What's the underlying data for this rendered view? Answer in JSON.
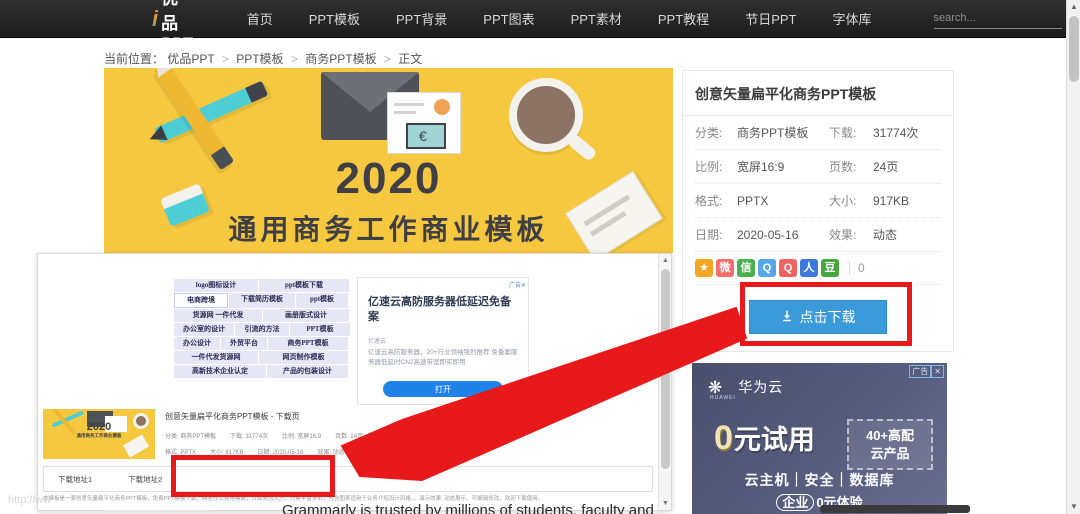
{
  "site": {
    "brand_mark": "i",
    "brand_name": "优品PPT",
    "nav": [
      {
        "label": "首页"
      },
      {
        "label": "PPT模板"
      },
      {
        "label": "PPT背景"
      },
      {
        "label": "PPT图表"
      },
      {
        "label": "PPT素材"
      },
      {
        "label": "PPT教程"
      },
      {
        "label": "节日PPT"
      },
      {
        "label": "字体库"
      }
    ],
    "search": {
      "placeholder": "search...",
      "value": "",
      "icon": "search-icon"
    }
  },
  "breadcrumb": {
    "prefix": "当前位置：",
    "items": [
      "优品PPT",
      "PPT模板",
      "商务PPT模板",
      "正文"
    ],
    "separator": ">"
  },
  "banner": {
    "year": "2020",
    "subtitle": "通用商务工作商业模板",
    "bg_color": "#f6c83f"
  },
  "info_panel": {
    "title": "创意矢量扁平化商务PPT模板",
    "rows": [
      {
        "k": "分类:",
        "v": "商务PPT模板",
        "k2": "下载:",
        "v2": "31774次"
      },
      {
        "k": "比例:",
        "v": "宽屏16:9",
        "k2": "页数:",
        "v2": "24页"
      },
      {
        "k": "格式:",
        "v": "PPTX",
        "k2": "大小:",
        "v2": "917KB"
      },
      {
        "k": "日期:",
        "v": "2020-05-16",
        "k2": "效果:",
        "v2": "动态"
      }
    ],
    "share": {
      "icons": [
        {
          "name": "favorite-star-icon",
          "glyph": "★",
          "color": "#f5a623"
        },
        {
          "name": "weibo-icon",
          "glyph": "微",
          "color": "#f26d6d"
        },
        {
          "name": "wechat-icon",
          "glyph": "信",
          "color": "#4caf50"
        },
        {
          "name": "qzone-icon",
          "glyph": "Q",
          "color": "#56a8e8"
        },
        {
          "name": "qq-icon",
          "glyph": "Q",
          "color": "#f06161"
        },
        {
          "name": "renren-icon",
          "glyph": "人",
          "color": "#3b78d8"
        },
        {
          "name": "douban-icon",
          "glyph": "豆",
          "color": "#46a63f"
        }
      ],
      "count": "0"
    },
    "download_button": {
      "label": "点击下载",
      "icon": "download-icon",
      "color": "#3b9ad9"
    }
  },
  "huawei_ad": {
    "tag": "广告",
    "close": "✕",
    "brand": "华为云",
    "brand_sub": "HUAWEI",
    "headline_zero": "0",
    "headline_rest": "元试用",
    "badge_line1": "40+高配",
    "badge_line2": "云产品",
    "features": "云主机｜安全｜数据库",
    "footer_pill": "企业",
    "footer_rest": "0元体验"
  },
  "popup": {
    "tags": [
      {
        "label": "logo图标设计",
        "highlight": false
      },
      {
        "label": "ppt模板下载",
        "highlight": false
      },
      {
        "label": "电商跨境",
        "highlight": true
      },
      {
        "label": "下载简历模板",
        "highlight": false
      },
      {
        "label": "ppt模板",
        "highlight": false
      },
      {
        "label": "货源网 一件代发",
        "highlight": false
      },
      {
        "label": "画册版式设计",
        "highlight": false
      },
      {
        "label": "办公室的设计",
        "highlight": false
      },
      {
        "label": "引流的方法",
        "highlight": false
      },
      {
        "label": "PPT模板",
        "highlight": false
      },
      {
        "label": "办公设计",
        "highlight": false
      },
      {
        "label": "外贸平台",
        "highlight": false
      },
      {
        "label": "商务PPT模板",
        "highlight": false
      },
      {
        "label": "一件代发货源网",
        "highlight": false
      },
      {
        "label": "网页制作模板",
        "highlight": false
      },
      {
        "label": "高新技术企业认定",
        "highlight": false
      },
      {
        "label": "产品的包装设计",
        "highlight": false
      }
    ],
    "inner_ad": {
      "tag": "广告✕",
      "title": "亿速云高防服务器低延迟免备案",
      "advertiser": "亿速云",
      "desc": "亿速云高防服务器，20+行业领袖强烈推荐 免备案服务器低延时CN2高速带宽即买即用",
      "button": "打开"
    },
    "detail": {
      "title": "创意矢量扁平化商务PPT模板 - 下载页",
      "thumb_year": "2020",
      "thumb_sub": "通用商务工作商业模板",
      "meta_row1": [
        "分类: 商务PPT模板",
        "下载: 31774次",
        "比例: 宽屏16:9",
        "页数: 24页"
      ],
      "meta_row2": [
        "格式: PPTX",
        "大小: 917KB",
        "日期: 2020-05-16",
        "效果: 动态"
      ]
    },
    "download_links": [
      {
        "label": "下载地址1"
      },
      {
        "label": "下载地址2"
      }
    ],
    "description": "本模板是一套创意矢量扁平化商务PPT模板，免费PPT模板下载，商务办公通用模板，页面简洁大方，元素丰富多彩，包含图表适用于业务介绍设计风格，，演示效果: 动态展示，可编辑修改，欢迎下载使用。"
  },
  "browser": {
    "status_url": "http://ww",
    "bottom_text": "Grammarly is trusted by millions of students, faculty and",
    "scroll_up": "▲",
    "scroll_down": "▼"
  }
}
